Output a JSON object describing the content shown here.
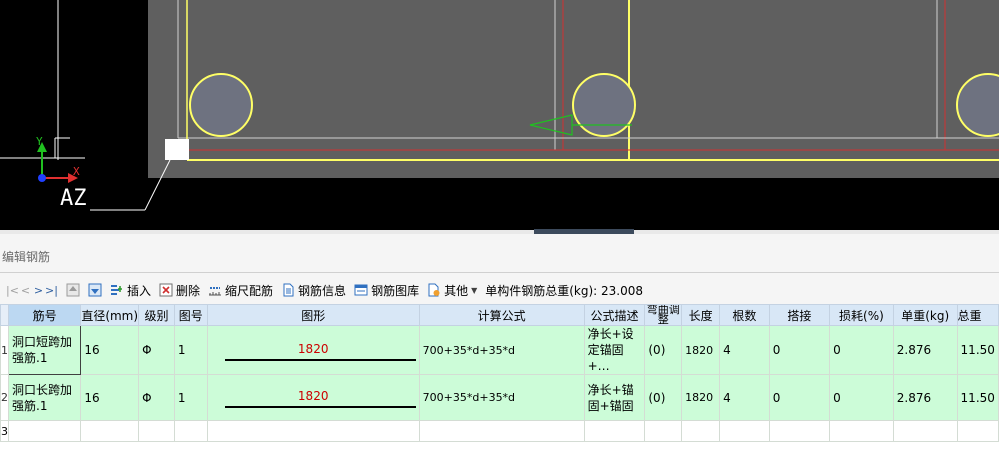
{
  "cad": {
    "label": "AZ",
    "x_axis": "X",
    "y_axis": "Y",
    "colors": {
      "background": "#000000",
      "slab": "#5f5f5f",
      "yellow": "#ffff66",
      "red": "#d03030",
      "green": "#20c020",
      "blue": "#2040ff"
    }
  },
  "panel": {
    "title": "编辑钢筋"
  },
  "toolbar": {
    "nav": [
      "|<",
      "<",
      ">",
      ">|"
    ],
    "insert": "插入",
    "delete": "删除",
    "scale": "缩尺配筋",
    "info": "钢筋信息",
    "library": "钢筋图库",
    "other": "其他",
    "total": "单构件钢筋总重(kg): 23.008"
  },
  "grid": {
    "headers": [
      "筋号",
      "直径(mm)",
      "级别",
      "图号",
      "图形",
      "计算公式",
      "公式描述",
      "弯曲调整",
      "长度",
      "根数",
      "搭接",
      "损耗(%)",
      "单重(kg)",
      "总重"
    ],
    "rows": [
      {
        "num": "1",
        "name": "洞口短跨加强筋.1",
        "diameter": "16",
        "grade": "Φ",
        "fig": "1",
        "shape_value": "1820",
        "formula": "700+35*d+35*d",
        "desc": "净长+设定锚固+…",
        "bend": "(0)",
        "length": "1820",
        "count": "4",
        "lap": "0",
        "loss": "0",
        "unit_weight": "2.876",
        "total_weight": "11.50"
      },
      {
        "num": "2",
        "name": "洞口长跨加强筋.1",
        "diameter": "16",
        "grade": "Φ",
        "fig": "1",
        "shape_value": "1820",
        "formula": "700+35*d+35*d",
        "desc": "净长+锚固+锚固",
        "bend": "(0)",
        "length": "1820",
        "count": "4",
        "lap": "0",
        "loss": "0",
        "unit_weight": "2.876",
        "total_weight": "11.50"
      }
    ],
    "empty_row_num": "3"
  }
}
